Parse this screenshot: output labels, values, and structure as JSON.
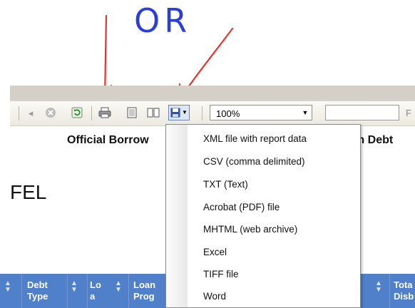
{
  "annotation": {
    "text": "OR",
    "color": "#2a3fd6",
    "arrow_color": "#e8322b"
  },
  "toolbar": {
    "zoom_value": "100%",
    "find_label": "F",
    "icons": [
      "back-icon",
      "stop-icon",
      "refresh-icon",
      "print-icon",
      "print-layout-icon",
      "page-setup-icon",
      "export-save-icon",
      "dropdown-arrow-icon"
    ]
  },
  "report": {
    "title_left": "Official Borrow",
    "title_right": "m Debt",
    "fel": "FEL"
  },
  "export_menu": {
    "items": [
      "XML file with report data",
      "CSV (comma delimited)",
      "TXT (Text)",
      "Acrobat (PDF) file",
      "MHTML (web archive)",
      "Excel",
      "TIFF file",
      "Word"
    ]
  },
  "table": {
    "header_color": "#4f80c9",
    "columns": [
      {
        "line1": "Debt",
        "line2": "Type"
      },
      {
        "line1": "Lo",
        "line2": "a"
      },
      {
        "line1": "Loan",
        "line2": "Prog"
      },
      {
        "line1": "Tota",
        "line2": "Disb"
      }
    ]
  }
}
